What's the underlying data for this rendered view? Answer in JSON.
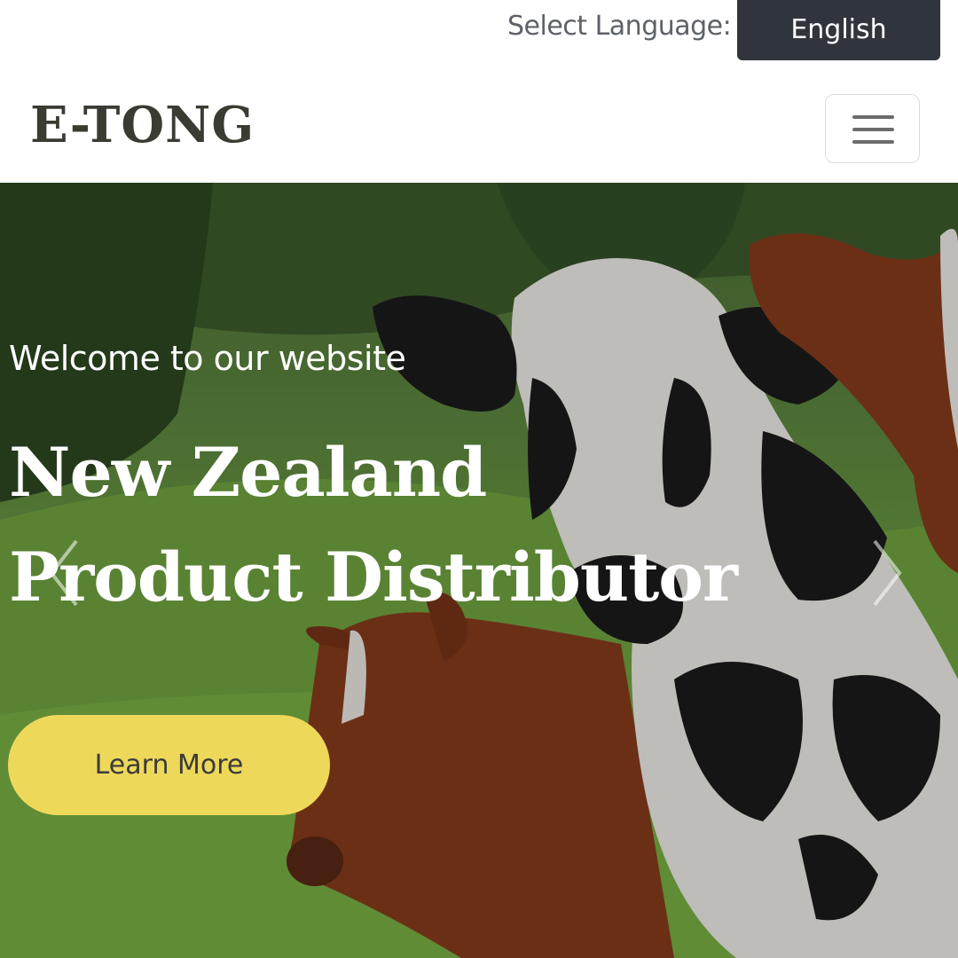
{
  "language_bar": {
    "label": "Select Language:",
    "selected_language": "English"
  },
  "navbar": {
    "logo_text": "E-TONG",
    "menu_icon": "hamburger-menu-icon"
  },
  "hero": {
    "welcome_text": "Welcome to our website",
    "headline_line1": "New Zealand",
    "headline_line2": "Product Distributor",
    "cta_label": "Learn More",
    "prev_icon": "chevron-left-icon",
    "next_icon": "chevron-right-icon"
  },
  "colors": {
    "language_button_bg": "#30343c",
    "logo_text": "#3a3b33",
    "cta_bg": "#edd85a",
    "pasture_green": "#6fa044"
  }
}
